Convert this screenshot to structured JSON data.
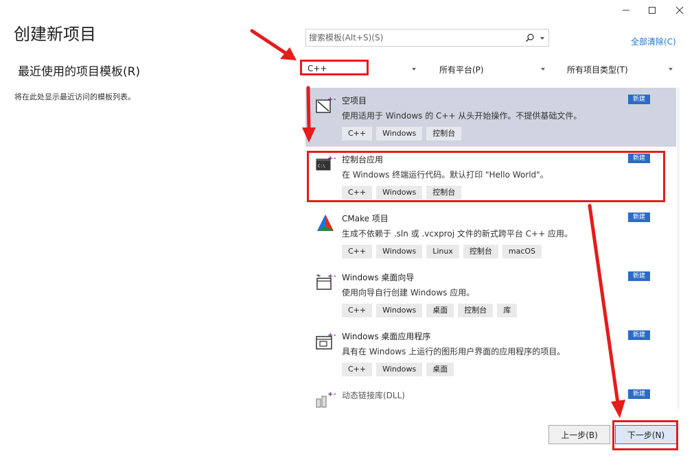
{
  "window": {
    "title": "创建新项目"
  },
  "recent": {
    "heading": "最近使用的项目模板(R)",
    "empty_text": "将在此处显示最近访问的模板列表。"
  },
  "search": {
    "placeholder": "搜索模板(Alt+S)(S)",
    "value": ""
  },
  "clear_all_label": "全部清除(C)",
  "filters": {
    "language": "C++",
    "platform": "所有平台(P)",
    "project_type": "所有项目类型(T)"
  },
  "templates": [
    {
      "name": "空项目",
      "description": "使用适用于 Windows 的 C++ 从头开始操作。不提供基础文件。",
      "badge": "新建",
      "tags": [
        "C++",
        "Windows",
        "控制台"
      ],
      "icon": "empty-project-icon",
      "selected": true
    },
    {
      "name": "控制台应用",
      "description": "在 Windows 终端运行代码。默认打印 \"Hello World\"。",
      "badge": "新建",
      "tags": [
        "C++",
        "Windows",
        "控制台"
      ],
      "icon": "console-app-icon",
      "selected": false
    },
    {
      "name": "CMake 项目",
      "description": "生成不依赖于 .sln 或 .vcxproj 文件的新式跨平台 C++ 应用。",
      "badge": "新建",
      "tags": [
        "C++",
        "Windows",
        "Linux",
        "控制台",
        "macOS"
      ],
      "icon": "cmake-icon",
      "selected": false
    },
    {
      "name": "Windows 桌面向导",
      "description": "使用向导自行创建 Windows 应用。",
      "badge": "新建",
      "tags": [
        "C++",
        "Windows",
        "桌面",
        "控制台",
        "库"
      ],
      "icon": "desktop-wizard-icon",
      "selected": false
    },
    {
      "name": "Windows 桌面应用程序",
      "description": "具有在 Windows 上运行的图形用户界面的应用程序的项目。",
      "badge": "新建",
      "tags": [
        "C++",
        "Windows",
        "桌面"
      ],
      "icon": "desktop-app-icon",
      "selected": false
    },
    {
      "name": "动态链接库(DLL)",
      "description": "",
      "badge": "新建",
      "tags": [],
      "icon": "dll-icon",
      "selected": false
    }
  ],
  "buttons": {
    "back": "上一步(B)",
    "next": "下一步(N)"
  },
  "colors": {
    "accent": "#2b6cc4",
    "selected_bg": "#cfd4e0",
    "annotation": "#e51c1c"
  }
}
